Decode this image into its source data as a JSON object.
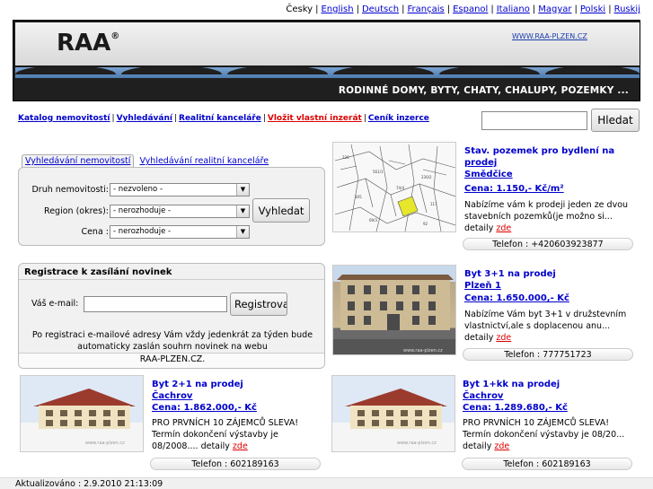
{
  "languages": [
    "Česky",
    "English",
    "Deutsch",
    "Français",
    "Espanol",
    "Italiano",
    "Magyar",
    "Polski",
    "Ruskij"
  ],
  "banner": {
    "logo": "RAA",
    "logo_mark": "®",
    "url": "WWW.RAA-PLZEN.CZ",
    "slogan": "RODINNÉ DOMY, BYTY, CHATY, CHALUPY, POZEMKY ..."
  },
  "nav": {
    "items": [
      "Katalog nemovitostí",
      "Vyhledávání",
      "Realitní kanceláře",
      "Vložit vlastní inzerát",
      "Ceník inzerce"
    ]
  },
  "site_search": {
    "placeholder": "",
    "button_label": "Hledat"
  },
  "search_panel": {
    "tabs": [
      "Vyhledávání nemovitostí",
      "Vyhledávání realitní kanceláře"
    ],
    "fields": [
      {
        "label": "Druh nemovitosti:",
        "value": "- nezvoleno -"
      },
      {
        "label": "Region (okres):",
        "value": "- nerozhoduje -"
      },
      {
        "label": "Cena :",
        "value": "- nerozhoduje -"
      }
    ],
    "button_label": "Vyhledat"
  },
  "newsletter": {
    "title": "Registrace k zasílání novinek",
    "email_label": "Váš e-mail:",
    "email_value": "",
    "button_label": "Registrovat",
    "info": "Po registraci e-mailové adresy Vám vždy jedenkrát za týden bude automaticky zaslán souhrn novinek na webu",
    "info_site": "RAA-PLZEN.CZ."
  },
  "listings": [
    {
      "title_lines": [
        "Stav. pozemek pro bydlení na",
        "prodej",
        "Smědčice"
      ],
      "price": "Cena: 1.150,- Kč/m²",
      "description": "Nabízíme vám k prodeji jeden ze dvou stavebních pozemků(je možno si... detaily",
      "detail_link": "zde",
      "phone": "Telefon : +420603923877"
    },
    {
      "title_lines": [
        "Byt 3+1 na prodej",
        "Plzeň 1"
      ],
      "price": "Cena: 1.650.000,- Kč",
      "description": "Nabízíme Vám byt 3+1 v družstevním vlastnictví,ale s doplacenou anu... detaily",
      "detail_link": "zde",
      "phone": "Telefon : 777751723"
    },
    {
      "title_lines": [
        "Byt 2+1 na prodej",
        "Čachrov"
      ],
      "price": "Cena: 1.862.000,- Kč",
      "description": "PRO PRVNÍCH 10 ZÁJEMCŮ SLEVA! Termín dokončení výstavby je 08/2008.... detaily",
      "detail_link": "zde",
      "phone": "Telefon : 602189163"
    },
    {
      "title_lines": [
        "Byt 1+kk na prodej",
        "Čachrov"
      ],
      "price": "Cena: 1.289.680,- Kč",
      "description": "PRO PRVNÍCH 10 ZÁJEMCŮ SLEVA! Termín dokončení výstavby je 08/20... detaily",
      "detail_link": "zde",
      "phone": "Telefon : 602189163"
    }
  ],
  "footer": {
    "updated": "Aktualizováno : 2.9.2010 21:13:09"
  }
}
